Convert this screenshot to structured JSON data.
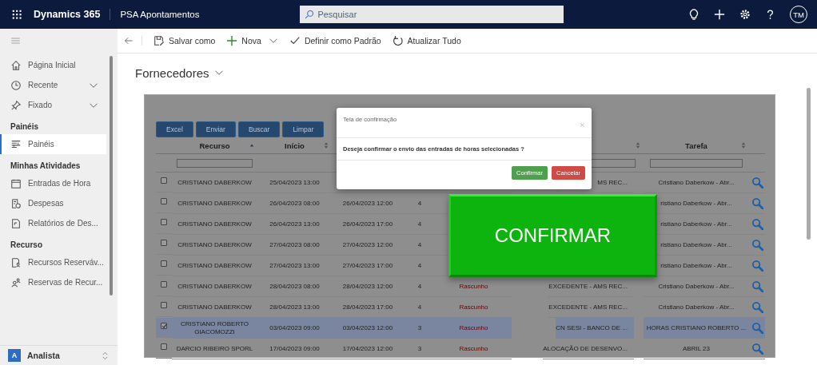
{
  "app_bar": {
    "app_name": "Dynamics 365",
    "module": "PSA Apontamentos",
    "search": {
      "placeholder": "Pesquisar"
    },
    "avatar": "TM"
  },
  "sidebar": {
    "items": [
      {
        "kind": "item",
        "label": "Página Inicial",
        "expandable": false,
        "selected": false
      },
      {
        "kind": "item",
        "label": "Recente",
        "expandable": true,
        "selected": false
      },
      {
        "kind": "item",
        "label": "Fixado",
        "expandable": true,
        "selected": false
      },
      {
        "kind": "header",
        "label": "Painéis"
      },
      {
        "kind": "item",
        "label": "Painéis",
        "expandable": false,
        "selected": true
      },
      {
        "kind": "header",
        "label": "Minhas Atividades"
      },
      {
        "kind": "item",
        "label": "Entradas de Hora",
        "expandable": false,
        "selected": false
      },
      {
        "kind": "item",
        "label": "Despesas",
        "expandable": false,
        "selected": false
      },
      {
        "kind": "item",
        "label": "Relatórios de Des...",
        "expandable": false,
        "selected": false
      },
      {
        "kind": "header",
        "label": "Recurso"
      },
      {
        "kind": "item",
        "label": "Recursos Reserváv...",
        "expandable": false,
        "selected": false
      },
      {
        "kind": "item",
        "label": "Reservas de Recur...",
        "expandable": false,
        "selected": false
      }
    ],
    "area": {
      "badge": "A",
      "label": "Analista"
    }
  },
  "command_bar": [
    {
      "label": "Salvar como",
      "dropdown": false
    },
    {
      "label": "Nova",
      "dropdown": true
    },
    {
      "label": "Definir como Padrão",
      "dropdown": false
    },
    {
      "label": "Atualizar Tudo",
      "dropdown": false
    }
  ],
  "view_title": "Fornecedores",
  "grid": {
    "buttons": [
      "Excel",
      "Enviar",
      "Buscar",
      "Limpar"
    ],
    "columns": [
      {
        "label": "Recurso",
        "sorted": true,
        "filter": true
      },
      {
        "label": "Início",
        "sorted": false,
        "filter": false
      },
      {
        "sorted": false,
        "filter": true
      },
      {
        "label": "Tarefa",
        "sorted": false,
        "filter": true
      }
    ],
    "rows": [
      {
        "checked": false,
        "recurso": "CRISTIANO DABERKOW",
        "inicio": "25/04/2023 13:00",
        "projeto": "MS REC...",
        "tarefa": "Cristiano Daberkow - Abr..."
      },
      {
        "checked": false,
        "recurso": "CRISTIANO DABERKOW",
        "inicio": "26/04/2023 08:00",
        "termino": "26/04/2023 12:00",
        "horas": "4",
        "tarefa": "ristiano Daberkow - Abr..."
      },
      {
        "checked": false,
        "recurso": "CRISTIANO DABERKOW",
        "inicio": "26/04/2023 13:00",
        "termino": "26/04/2023 17:00",
        "horas": "4",
        "tarefa": "ristiano Daberkow - Abr..."
      },
      {
        "checked": false,
        "recurso": "CRISTIANO DABERKOW",
        "inicio": "27/04/2023 08:00",
        "termino": "27/04/2023 12:00",
        "horas": "4",
        "tarefa": "ristiano Daberkow - Abr..."
      },
      {
        "checked": false,
        "recurso": "CRISTIANO DABERKOW",
        "inicio": "27/04/2023 13:00",
        "termino": "27/04/2023 17:00",
        "horas": "4",
        "tarefa": "ristiano Daberkow - Abr..."
      },
      {
        "checked": false,
        "recurso": "CRISTIANO DABERKOW",
        "inicio": "28/04/2023 08:00",
        "termino": "28/04/2023 12:00",
        "horas": "4",
        "status": "Rascunho",
        "projeto": "EXCEDENTE - AMS REC...",
        "tarefa": "Cristiano Daberkow - Abr..."
      },
      {
        "checked": false,
        "recurso": "CRISTIANO DABERKOW",
        "inicio": "28/04/2023 13:00",
        "termino": "28/04/2023 17:00",
        "horas": "4",
        "status": "Rascunho",
        "projeto": "EXCEDENTE - AMS REC...",
        "tarefa": "Cristiano Daberkow - Abr..."
      },
      {
        "checked": true,
        "recurso": "CRISTIANO ROBERTO GIACOMOZZI",
        "inicio": "03/04/2023 09:00",
        "termino": "03/04/2023 12:00",
        "horas": "3",
        "status": "Rascunho",
        "projeto": "CN SESI - BANCO DE ...",
        "tarefa": "HORAS CRISTIANO ROBERTO ..."
      },
      {
        "checked": false,
        "recurso": "DARCIO RIBEIRO SPORL",
        "inicio": "17/04/2023 09:00",
        "termino": "17/04/2023 12:00",
        "horas": "3",
        "status": "Rascunho",
        "projeto": "ALOCAÇÃO DE DESENVO...",
        "tarefa": "ABRIL 23"
      }
    ]
  },
  "dialog": {
    "title": "Tela de confirmação",
    "message": "Deseja confirmar o envio das entradas de horas selecionadas ?",
    "buttons": [
      {
        "label": "Confirmar",
        "kind": "primary"
      },
      {
        "label": "Cancelar",
        "kind": "danger"
      }
    ]
  },
  "callout_button": "CONFIRMAR"
}
